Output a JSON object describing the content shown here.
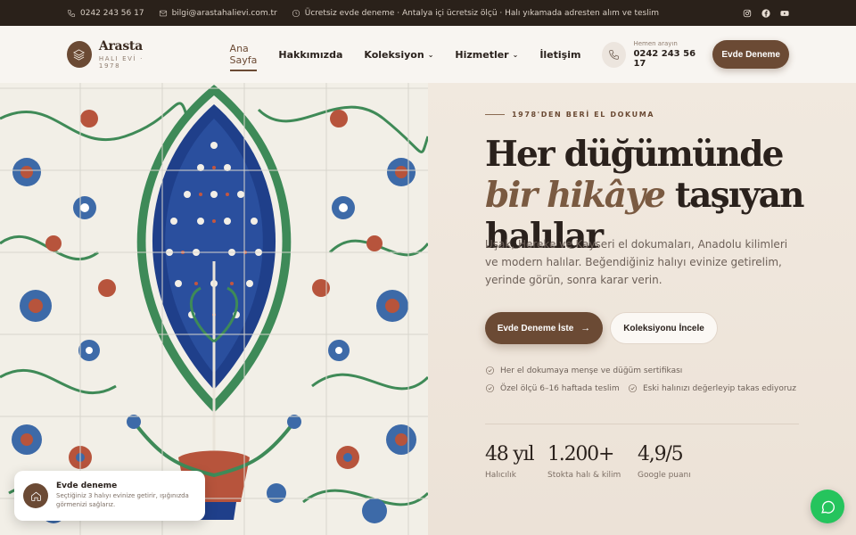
{
  "topbar": {
    "phone": "0242 243 56 17",
    "email": "bilgi@arastahalievi.com.tr",
    "notice": "Ücretsiz evde deneme · Antalya içi ücretsiz ölçü · Halı yıkamada adresten alım ve teslim",
    "social": [
      "instagram-icon",
      "facebook-icon",
      "youtube-icon"
    ]
  },
  "header": {
    "brand_name": "Arasta",
    "brand_sub": "HALI EVİ · 1978",
    "nav": [
      {
        "label": "Ana Sayfa",
        "active": true
      },
      {
        "label": "Hakkımızda"
      },
      {
        "label": "Koleksiyon",
        "dropdown": true
      },
      {
        "label": "Hizmetler",
        "dropdown": true
      },
      {
        "label": "İletişim"
      }
    ],
    "call_label": "Hemen arayın",
    "call_number": "0242 243 56 17",
    "cta": "Evde Deneme"
  },
  "hero": {
    "eyebrow": "1978'DEN BERİ EL DOKUMA",
    "headline_part1": "Her düğümünde ",
    "headline_em1": "bir hikâye",
    "headline_part2": " taşıyan halılar",
    "lead": "Uşak, Hereke ve Kayseri el dokumaları, Anadolu kilimleri ve modern halılar. Beğendiğiniz halıyı evinize getirelim, yerinde görün, sonra karar verin.",
    "btn_primary": "Evde Deneme İste",
    "btn_secondary": "Koleksiyonu İncele",
    "features": [
      "Her el dokumaya menşe ve düğüm sertifikası",
      "Özel ölçü 6–16 haftada teslim",
      "Eski halınızı değerleyip takas ediyoruz"
    ],
    "stats": [
      {
        "value": "48 yıl",
        "label": "Halıcılık"
      },
      {
        "value": "1.200+",
        "label": "Stokta halı & kilim"
      },
      {
        "value": "4,9/5",
        "label": "Google puanı"
      }
    ]
  },
  "toast": {
    "title": "Evde deneme",
    "body": "Seçtiğiniz 3 halıyı evinize getirir, ışığınızda görmenizi sağlarız."
  },
  "colors": {
    "brand": "#6b4a34",
    "topbar_bg": "#2a211a",
    "hero_bg": "#efe6dc",
    "whatsapp": "#25c45d"
  }
}
